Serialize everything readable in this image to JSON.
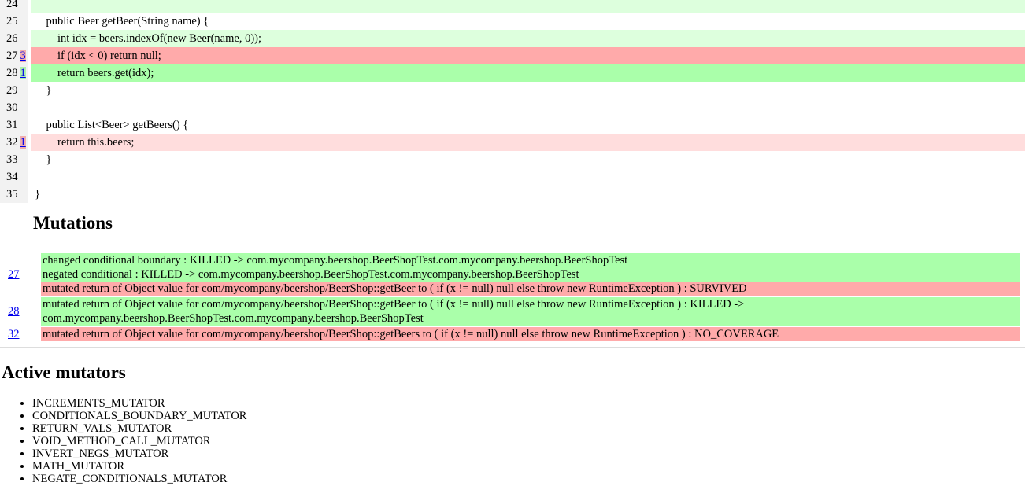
{
  "code": {
    "lines": [
      {
        "num": "24",
        "count": "",
        "text": "",
        "style": "covered-top"
      },
      {
        "num": "25",
        "count": "",
        "text": "    public Beer getBeer(String name) {",
        "style": "none"
      },
      {
        "num": "26",
        "count": "",
        "text": "        int idx = beers.indexOf(new Beer(name, 0));",
        "style": "covered"
      },
      {
        "num": "27",
        "count": "3",
        "text": "        if (idx < 0) return null;",
        "style": "mixed"
      },
      {
        "num": "28",
        "count": "1",
        "text": "        return beers.get(idx);",
        "style": "killed"
      },
      {
        "num": "29",
        "count": "",
        "text": "    }",
        "style": "none"
      },
      {
        "num": "30",
        "count": "",
        "text": "",
        "style": "none"
      },
      {
        "num": "31",
        "count": "",
        "text": "    public List<Beer> getBeers() {",
        "style": "none"
      },
      {
        "num": "32",
        "count": "1",
        "text": "        return this.beers;",
        "style": "uncovered"
      },
      {
        "num": "33",
        "count": "",
        "text": "    }",
        "style": "none"
      },
      {
        "num": "34",
        "count": "",
        "text": "",
        "style": "none"
      },
      {
        "num": "35",
        "count": "",
        "text": "}",
        "style": "none"
      }
    ]
  },
  "mutations": {
    "title": "Mutations",
    "groups": [
      {
        "line": "27",
        "items": [
          {
            "text": "changed conditional boundary : KILLED -> com.mycompany.beershop.BeerShopTest.com.mycompany.beershop.BeerShopTest",
            "status": "killed"
          },
          {
            "text": "negated conditional : KILLED -> com.mycompany.beershop.BeerShopTest.com.mycompany.beershop.BeerShopTest",
            "status": "killed"
          },
          {
            "text": "mutated return of Object value for com/mycompany/beershop/BeerShop::getBeer to ( if (x != null) null else throw new RuntimeException ) : SURVIVED",
            "status": "survived"
          }
        ]
      },
      {
        "line": "28",
        "items": [
          {
            "text": "mutated return of Object value for com/mycompany/beershop/BeerShop::getBeer to ( if (x != null) null else throw new RuntimeException ) : KILLED ->",
            "status": "killed"
          },
          {
            "text": "com.mycompany.beershop.BeerShopTest.com.mycompany.beershop.BeerShopTest",
            "status": "killed"
          }
        ]
      },
      {
        "line": "32",
        "items": [
          {
            "text": "mutated return of Object value for com/mycompany/beershop/BeerShop::getBeers to ( if (x != null) null else throw new RuntimeException ) : NO_COVERAGE",
            "status": "nocov"
          }
        ]
      }
    ]
  },
  "mutators": {
    "title": "Active mutators",
    "items": [
      "INCREMENTS_MUTATOR",
      "CONDITIONALS_BOUNDARY_MUTATOR",
      "RETURN_VALS_MUTATOR",
      "VOID_METHOD_CALL_MUTATOR",
      "INVERT_NEGS_MUTATOR",
      "MATH_MUTATOR",
      "NEGATE_CONDITIONALS_MUTATOR"
    ]
  },
  "colors": {
    "covered": "#ddffdd",
    "uncovered": "#ffdddd",
    "killed": "#aaffaa",
    "survived": "#ffaaaa",
    "link": "#0000ee"
  }
}
